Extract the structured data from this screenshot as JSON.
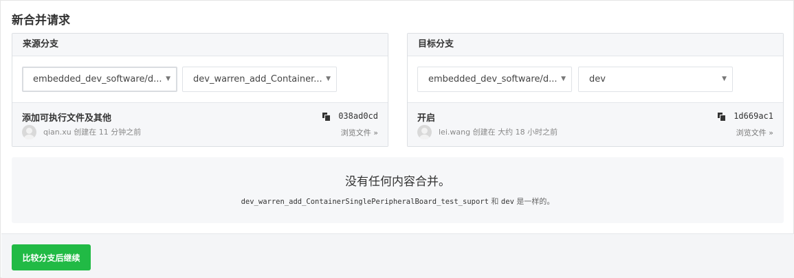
{
  "page_title": "新合并请求",
  "source": {
    "header": "来源分支",
    "repo_select": "embedded_dev_software/d...",
    "branch_select": "dev_warren_add_Container...",
    "commit": {
      "title": "添加可执行文件及其他",
      "author": "qian.xu",
      "time": "创建在 11 分钟之前",
      "sha": "038ad0cd",
      "browse": "浏览文件 »"
    }
  },
  "target": {
    "header": "目标分支",
    "repo_select": "embedded_dev_software/d...",
    "branch_select": "dev",
    "commit": {
      "title": "开启",
      "author": "lei.wang",
      "time": "创建在 大约 18 小时之前",
      "sha": "1d669ac1",
      "browse": "浏览文件 »"
    }
  },
  "notice": {
    "title": "没有任何内容合并。",
    "source_branch": "dev_warren_add_ContainerSinglePeripheralBoard_test_suport",
    "and_text": "和",
    "target_branch": "dev",
    "same_text": "是一样的。"
  },
  "footer": {
    "compare_button": "比较分支后继续",
    "button_color": "#21ba45"
  },
  "icons": {
    "caret": "chevron-down-icon",
    "copy": "copy-icon"
  }
}
